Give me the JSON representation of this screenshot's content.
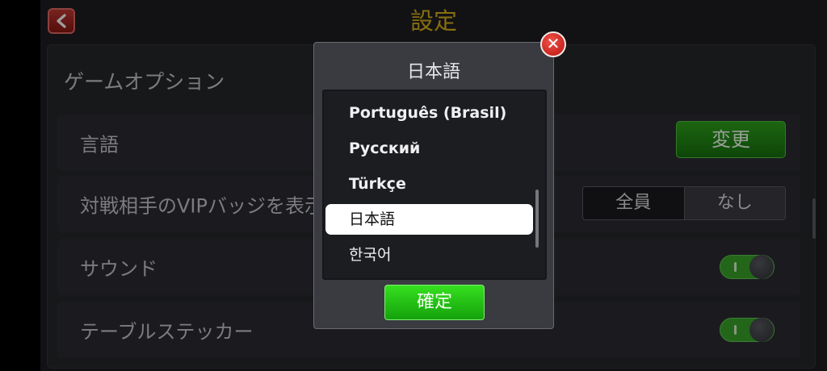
{
  "header": {
    "title": "設定",
    "back_icon": "chevron-left-icon"
  },
  "panel": {
    "section_title": "ゲームオプション",
    "rows": [
      {
        "label": "言語",
        "button_label": "変更"
      },
      {
        "label": "対戦相手のVIPバッジを表示",
        "options": [
          "全員",
          "なし"
        ],
        "selected": "全員"
      },
      {
        "label": "サウンド",
        "toggle_on": true
      },
      {
        "label": "テーブルステッカー",
        "toggle_on": true
      }
    ]
  },
  "dialog": {
    "title": "日本語",
    "close_icon": "close-icon",
    "close_glyph": "✕",
    "languages": [
      "Português (Brasil)",
      "Русский",
      "Türkçe",
      "日本語",
      "한국어"
    ],
    "selected_language": "日本語",
    "confirm_label": "確定"
  },
  "colors": {
    "title_gold": "#d8b21a",
    "green_button": "#2ea41c",
    "close_red": "#d9241c"
  }
}
